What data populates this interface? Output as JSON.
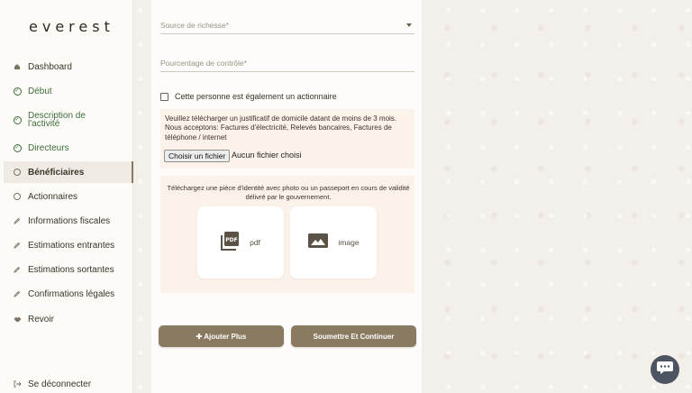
{
  "brand": {
    "logo": "everest"
  },
  "sidebar": {
    "items": [
      {
        "label": "Dashboard",
        "icon": "home-icon",
        "state": "normal"
      },
      {
        "label": "Début",
        "icon": "check-circle-icon",
        "state": "done"
      },
      {
        "label": "Description de l'activité",
        "icon": "check-circle-icon",
        "state": "done"
      },
      {
        "label": "Directeurs",
        "icon": "check-circle-icon",
        "state": "done"
      },
      {
        "label": "Bénéficiaires",
        "icon": "circle-icon",
        "state": "active"
      },
      {
        "label": "Actionnaires",
        "icon": "circle-icon",
        "state": "normal"
      },
      {
        "label": "Informations fiscales",
        "icon": "pencil-icon",
        "state": "normal"
      },
      {
        "label": "Estimations entrantes",
        "icon": "pencil-icon",
        "state": "normal"
      },
      {
        "label": "Estimations sortantes",
        "icon": "pencil-icon",
        "state": "normal"
      },
      {
        "label": "Confirmations légales",
        "icon": "pencil-icon",
        "state": "normal"
      },
      {
        "label": "Revoir",
        "icon": "handshake-icon",
        "state": "normal"
      }
    ],
    "logout": {
      "label": "Se déconnecter",
      "icon": "logout-icon"
    }
  },
  "form": {
    "source_placeholder": "Source de richesse*",
    "control_placeholder": "Pourcentage de contrôle*",
    "shareholder_checkbox": "Cette personne est également un actionnaire",
    "address_notice": "Veuillez télécharger un justificatif de domicile datant de moins de 3 mois. Nous acceptons: Factures d'électricité, Relevés bancaires, Factures de téléphone / internet",
    "file_button": "Choisir un fichier",
    "file_none": "Aucun fichier choisi",
    "id_notice": "Téléchargez une pièce d'identité avec photo ou un passeport en cours de validité délivré par le gouvernement.",
    "tiles": [
      {
        "label": "pdf",
        "icon": "pdf-icon"
      },
      {
        "label": "image",
        "icon": "image-icon"
      }
    ],
    "add_more": "✚ Ajouter Plus",
    "submit": "Soumettre Et Continuer"
  },
  "colors": {
    "accent": "#8a7a62",
    "done": "#3e6b3a",
    "panel": "#fbf2ea",
    "chat": "#4c5561"
  }
}
